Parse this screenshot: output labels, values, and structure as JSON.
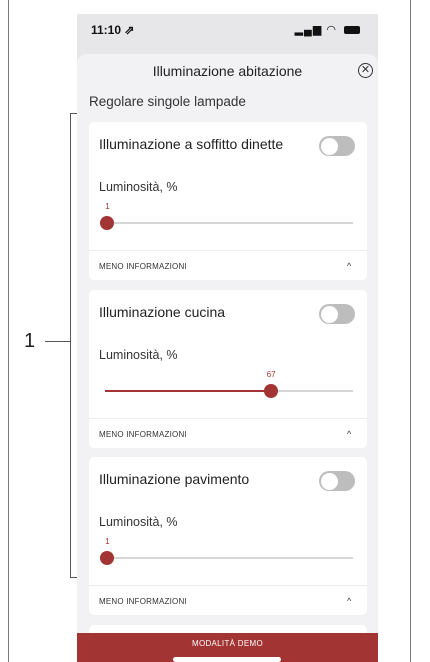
{
  "callout": {
    "number": "1"
  },
  "status_bar": {
    "time": "11:10 ⇗",
    "icons": "▂▄▆ ◠"
  },
  "sheet": {
    "title": "Illuminazione abitazione",
    "close_symbol": "✕",
    "section_title": "Regolare singole lampade"
  },
  "cards": [
    {
      "name": "Illuminazione a soffitto dinette",
      "toggle_on": false,
      "brightness_label": "Luminosità, %",
      "brightness_value": "1",
      "brightness_percent": 1,
      "more_info": "MENO INFORMAZIONI",
      "chevron": "^"
    },
    {
      "name": "Illuminazione cucina",
      "toggle_on": false,
      "brightness_label": "Luminosità, %",
      "brightness_value": "67",
      "brightness_percent": 67,
      "more_info": "MENO INFORMAZIONI",
      "chevron": "^"
    },
    {
      "name": "Illuminazione pavimento",
      "toggle_on": false,
      "brightness_label": "Luminosità, %",
      "brightness_value": "1",
      "brightness_percent": 1,
      "more_info": "MENO INFORMAZIONI",
      "chevron": "^"
    }
  ],
  "demo_bar": {
    "label": "MODALITÀ DEMO"
  },
  "colors": {
    "accent": "#a33434",
    "toggle_off": "#bdbdbd",
    "background": "#f2f2f4"
  }
}
